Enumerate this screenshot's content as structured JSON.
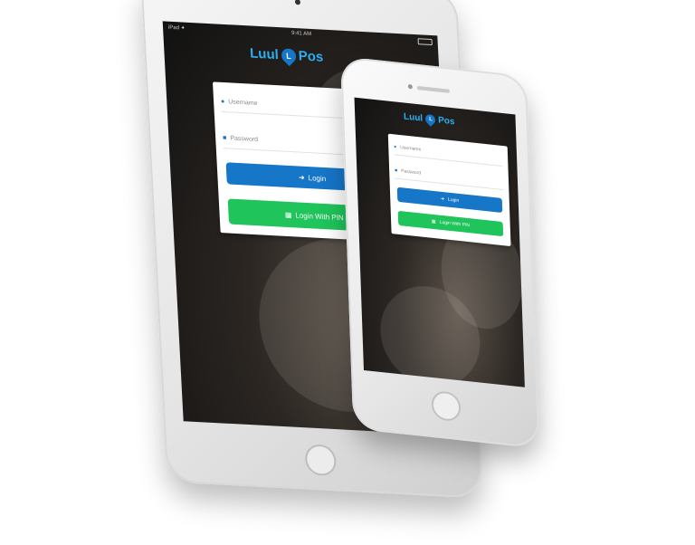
{
  "brand": {
    "word1": "Luul",
    "badge": "L",
    "word2": "Pos"
  },
  "tablet": {
    "status_left": "iPad ✦",
    "status_center": "9:41 AM",
    "username_placeholder": "Username",
    "password_placeholder": "Password",
    "login_label": "Login",
    "login_pin_label": "Login With PIN"
  },
  "phone": {
    "username_placeholder": "Username",
    "password_placeholder": "Password",
    "login_label": "Login",
    "login_pin_label": "Login With PIN"
  },
  "colors": {
    "login_button": "#1676c8",
    "pin_button": "#1fc45a",
    "logo_text": "#2ab0f0"
  },
  "icons": {
    "user": "user-icon",
    "lock": "lock-icon",
    "sign_in": "sign-in-icon",
    "grid": "grid-icon"
  }
}
